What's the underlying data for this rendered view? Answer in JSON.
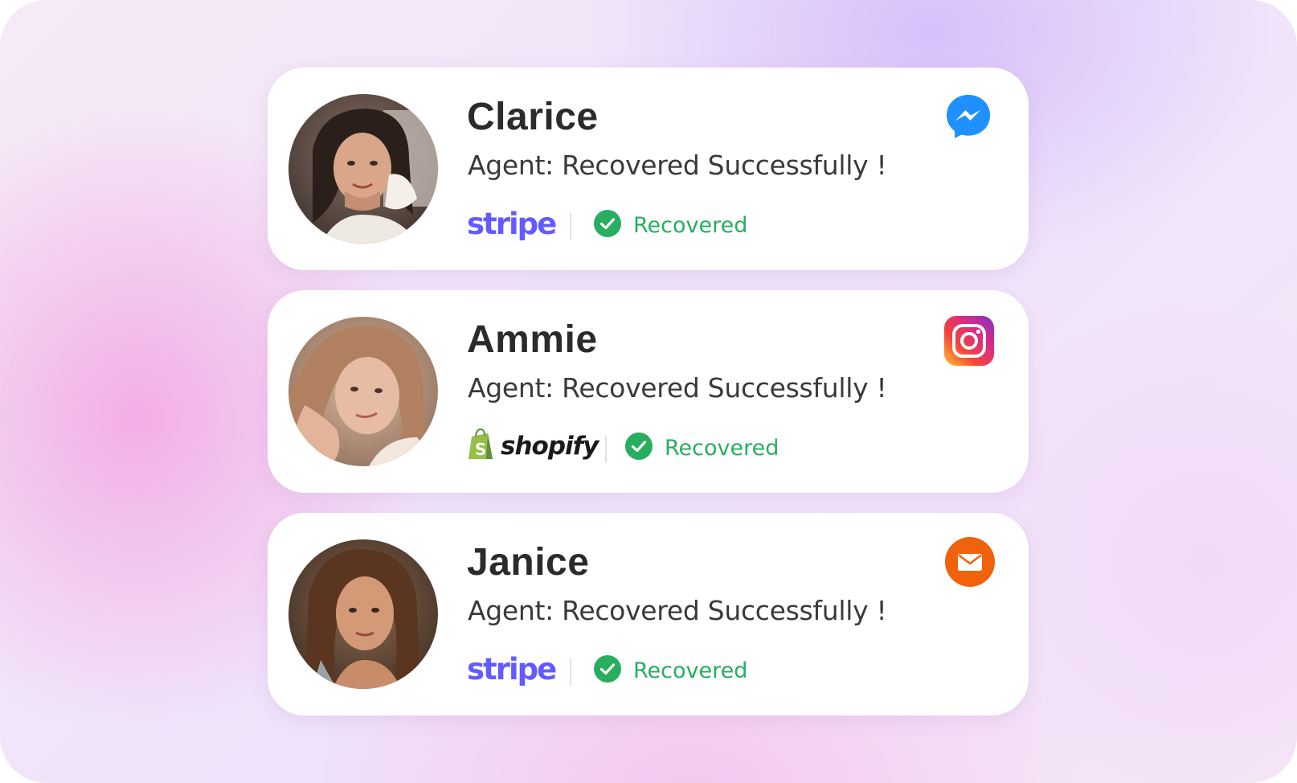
{
  "cards": [
    {
      "name": "Clarice",
      "message": "Agent: Recovered Successfully !",
      "platform": "stripe",
      "platform_label": "stripe",
      "status": "Recovered",
      "channel_icon": "messenger-icon"
    },
    {
      "name": "Ammie",
      "message": "Agent: Recovered Successfully !",
      "platform": "shopify",
      "platform_label": "shopify",
      "status": "Recovered",
      "channel_icon": "instagram-icon"
    },
    {
      "name": "Janice",
      "message": "Agent: Recovered Successfully !",
      "platform": "stripe",
      "platform_label": "stripe",
      "status": "Recovered",
      "channel_icon": "email-icon"
    }
  ],
  "colors": {
    "stripe": "#635bff",
    "recovered": "#27ae60",
    "messenger": "#1e90ff",
    "email": "#f0620c",
    "shopify": "#95bf47"
  }
}
